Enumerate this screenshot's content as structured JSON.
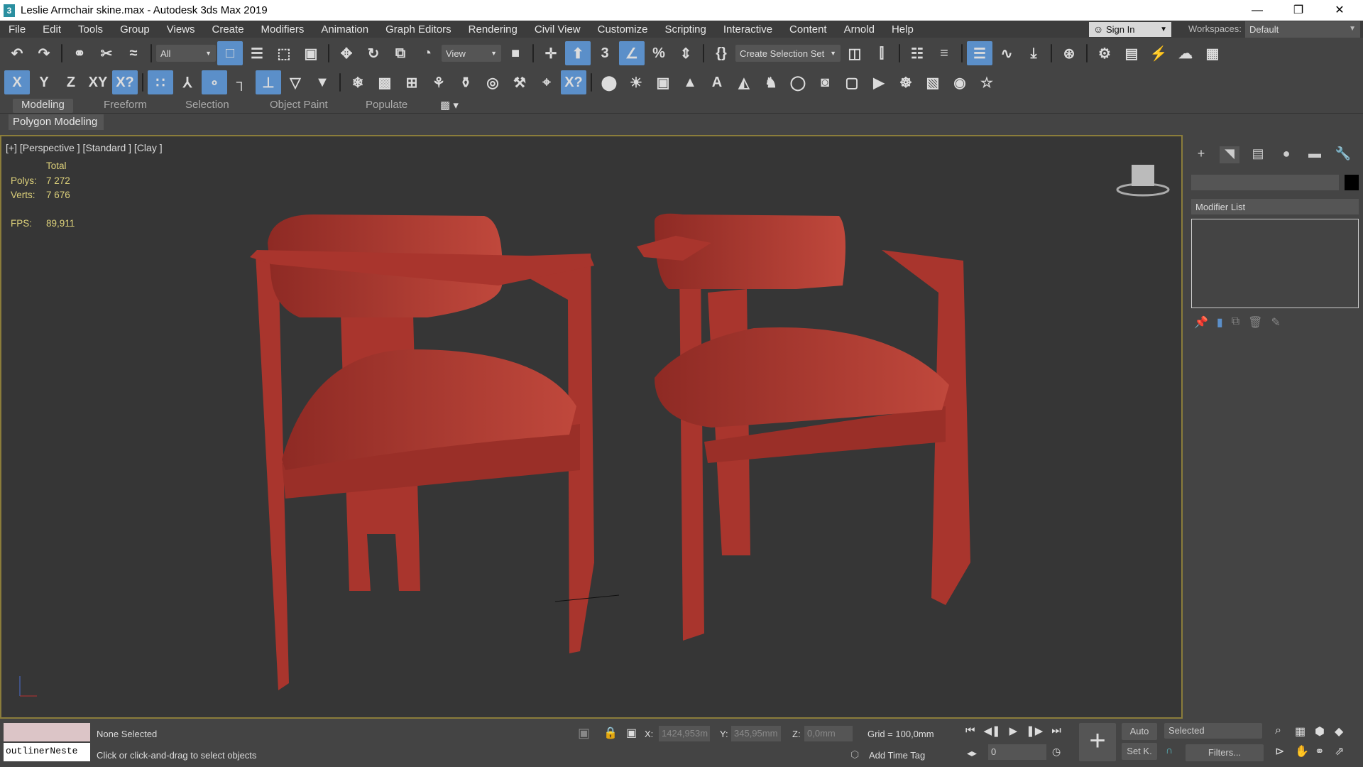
{
  "window": {
    "title": "Leslie Armchair skine.max - Autodesk 3ds Max 2019",
    "app_icon": "3",
    "minimize": "—",
    "restore": "❐",
    "close": "✕"
  },
  "menu": [
    "File",
    "Edit",
    "Tools",
    "Group",
    "Views",
    "Create",
    "Modifiers",
    "Animation",
    "Graph Editors",
    "Rendering",
    "Civil View",
    "Customize",
    "Scripting",
    "Interactive",
    "Content",
    "Arnold",
    "Help"
  ],
  "account": {
    "sign_in": "Sign In",
    "workspaces_label": "Workspaces:",
    "workspace": "Default"
  },
  "toolbar1": [
    {
      "n": "undo-icon",
      "g": "↶"
    },
    {
      "n": "redo-icon",
      "g": "↷"
    },
    {
      "sep": 1
    },
    {
      "n": "link-icon",
      "g": "⚭"
    },
    {
      "n": "unlink-icon",
      "g": "✂"
    },
    {
      "n": "bind-space-warp-icon",
      "g": "≈"
    },
    {
      "sep": 1
    },
    {
      "n": "selection-filter-dropdown",
      "dd": "All"
    },
    {
      "n": "select-object-icon",
      "g": "□",
      "on": 1
    },
    {
      "n": "select-by-name-icon",
      "g": "☰"
    },
    {
      "n": "rectangular-selection-icon",
      "g": "⬚"
    },
    {
      "n": "window-crossing-icon",
      "g": "▣"
    },
    {
      "sep": 1
    },
    {
      "n": "move-icon",
      "g": "✥"
    },
    {
      "n": "rotate-icon",
      "g": "↻"
    },
    {
      "n": "scale-icon",
      "g": "⧉"
    },
    {
      "n": "place-icon",
      "g": "◔"
    },
    {
      "n": "reference-coordinate-dropdown",
      "dd": "View"
    },
    {
      "n": "pivot-center-icon",
      "g": "■"
    },
    {
      "sep": 1
    },
    {
      "n": "manipulate-icon",
      "g": "✛"
    },
    {
      "n": "keyboard-shortcut-override-icon",
      "g": "⬆",
      "on": 1
    },
    {
      "n": "snaps-toggle-icon",
      "g": "3"
    },
    {
      "n": "angle-snap-icon",
      "g": "∠",
      "on": 1
    },
    {
      "n": "percent-snap-icon",
      "g": "%"
    },
    {
      "n": "spinner-snap-icon",
      "g": "⇕"
    },
    {
      "sep": 1
    },
    {
      "n": "edit-named-selection-icon",
      "g": "{}"
    },
    {
      "n": "named-selection-dropdown",
      "dd": "Create Selection Set",
      "wide": 1
    },
    {
      "n": "mirror-icon",
      "g": "◫"
    },
    {
      "n": "align-icon",
      "g": "⫿"
    },
    {
      "sep": 1
    },
    {
      "n": "scene-explorer-icon",
      "g": "☷"
    },
    {
      "n": "layer-explorer-icon",
      "g": "≡"
    },
    {
      "sep": 1
    },
    {
      "n": "ribbon-toggle-icon",
      "g": "☰",
      "on": 1
    },
    {
      "n": "curve-editor-icon",
      "g": "∿"
    },
    {
      "n": "schematic-view-icon",
      "g": "⤓"
    },
    {
      "sep": 1
    },
    {
      "n": "material-editor-icon",
      "g": "⊛"
    },
    {
      "sep": 1
    },
    {
      "n": "render-setup-icon",
      "g": "⚙"
    },
    {
      "n": "rendered-frame-window-icon",
      "g": "▤"
    },
    {
      "n": "render-production-icon",
      "g": "⚡"
    },
    {
      "n": "render-cloud-icon",
      "g": "☁"
    },
    {
      "n": "render-gallery-icon",
      "g": "▦"
    }
  ],
  "toolbar2": [
    {
      "n": "constraint-x-icon",
      "g": "X",
      "on": 1
    },
    {
      "n": "constraint-y-icon",
      "g": "Y"
    },
    {
      "n": "constraint-z-icon",
      "g": "Z"
    },
    {
      "n": "constraint-xy-icon",
      "g": "XY"
    },
    {
      "n": "snap-xy-icon",
      "g": "X?",
      "on": 1
    },
    {
      "sep": 1
    },
    {
      "n": "grid-points-snap-icon",
      "g": "∷",
      "on": 1
    },
    {
      "n": "pivot-snap-icon",
      "g": "⅄"
    },
    {
      "n": "vertex-snap-icon",
      "g": "∘",
      "on": 1
    },
    {
      "n": "endpoint-snap-icon",
      "g": "┐"
    },
    {
      "n": "midpoint-snap-icon",
      "g": "⊥",
      "on": 1
    },
    {
      "n": "edge-snap-icon",
      "g": "▽"
    },
    {
      "n": "face-snap-icon",
      "g": "▼"
    },
    {
      "sep": 1
    },
    {
      "n": "freeze-icon",
      "g": "❄"
    },
    {
      "n": "bounding-box-snap-icon",
      "g": "▩"
    },
    {
      "n": "perpendicular-icon",
      "g": "⊞"
    },
    {
      "n": "tangent-icon",
      "g": "⚘"
    },
    {
      "n": "vase-icon",
      "g": "⚱"
    },
    {
      "n": "sphere-icon",
      "g": "◎"
    },
    {
      "n": "tool-icon",
      "g": "⚒"
    },
    {
      "n": "snap-options-icon",
      "g": "⌖"
    },
    {
      "n": "snap-toggle-xy-icon",
      "g": "X?",
      "on": 1
    },
    {
      "sep": 1
    },
    {
      "n": "light-bulb-icon",
      "g": "⬤"
    },
    {
      "n": "sun-icon",
      "g": "☀"
    },
    {
      "n": "camera-icon",
      "g": "▣"
    },
    {
      "n": "particles-icon",
      "g": "▲"
    },
    {
      "n": "text-icon",
      "g": "A"
    },
    {
      "n": "mirror-object-icon",
      "g": "◭"
    },
    {
      "n": "chess-icon",
      "g": "♞"
    },
    {
      "n": "torus-icon",
      "g": "◯"
    },
    {
      "n": "teapot-render-icon",
      "g": "◙"
    },
    {
      "n": "box-icon",
      "g": "▢"
    },
    {
      "n": "video-icon",
      "g": "▶"
    },
    {
      "n": "film-icon",
      "g": "☸"
    },
    {
      "n": "viewport-icon",
      "g": "▧"
    },
    {
      "n": "eye-icon",
      "g": "◉"
    },
    {
      "n": "light-icon",
      "g": "☆"
    }
  ],
  "ribbon": {
    "tabs": [
      "Modeling",
      "Freeform",
      "Selection",
      "Object Paint",
      "Populate"
    ],
    "sub": "Polygon Modeling"
  },
  "viewport": {
    "label": "[+] [Perspective ] [Standard ] [Clay ]",
    "stats": {
      "header": "Total",
      "polys_label": "Polys:",
      "polys": "7 272",
      "verts_label": "Verts:",
      "verts": "7 676",
      "fps_label": "FPS:",
      "fps": "89,911"
    }
  },
  "command_panel": {
    "modifier_list": "Modifier List"
  },
  "status": {
    "selection": "None Selected",
    "prompt": "Click or click-and-drag to select objects",
    "script_listener": "outlinerNeste",
    "x_label": "X:",
    "x": "1424,953m",
    "y_label": "Y:",
    "y": "345,95mm",
    "z_label": "Z:",
    "z": "0,0mm",
    "grid": "Grid = 100,0mm",
    "add_time_tag": "Add Time Tag",
    "frame": "0",
    "auto": "Auto",
    "set_key": "Set K.",
    "key_filter": "Selected",
    "filters": "Filters..."
  },
  "colors": {
    "chair": "#b23a32",
    "viewport_border": "#8b7d3b",
    "accent": "#5b8fc9"
  }
}
